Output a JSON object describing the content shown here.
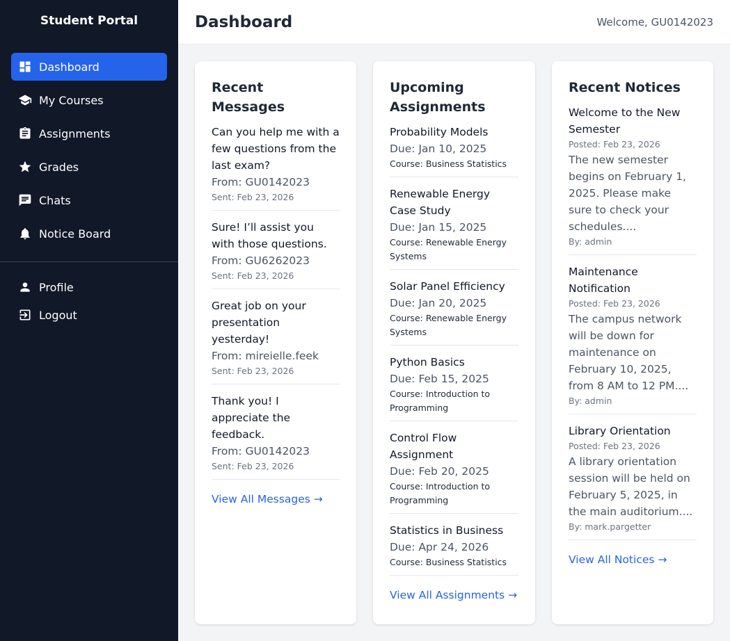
{
  "sidebar": {
    "brand": "Student Portal",
    "items": [
      {
        "label": "Dashboard",
        "icon": "dashboard-icon",
        "active": true
      },
      {
        "label": "My Courses",
        "icon": "school-icon"
      },
      {
        "label": "Assignments",
        "icon": "assignment-icon"
      },
      {
        "label": "Grades",
        "icon": "star-icon"
      },
      {
        "label": "Chats",
        "icon": "chat-icon"
      },
      {
        "label": "Notice Board",
        "icon": "bell-icon"
      }
    ],
    "bottom_items": [
      {
        "label": "Profile",
        "icon": "person-icon"
      },
      {
        "label": "Logout",
        "icon": "logout-icon"
      }
    ]
  },
  "header": {
    "title": "Dashboard",
    "welcome": "Welcome, GU0142023"
  },
  "messages": {
    "title": "Recent Messages",
    "items": [
      {
        "text": "Can you help me with a few questions from the last exam?",
        "from": "From: GU0142023",
        "sent": "Sent: Feb 23, 2026"
      },
      {
        "text": "Sure! I’ll assist you with those questions.",
        "from": "From: GU6262023",
        "sent": "Sent: Feb 23, 2026"
      },
      {
        "text": "Great job on your presentation yesterday!",
        "from": "From: mireielle.feek",
        "sent": "Sent: Feb 23, 2026"
      },
      {
        "text": "Thank you! I appreciate the feedback.",
        "from": "From: GU0142023",
        "sent": "Sent: Feb 23, 2026"
      }
    ],
    "view_all": "View All Messages →"
  },
  "assignments": {
    "title": "Upcoming Assignments",
    "items": [
      {
        "title": "Probability Models",
        "due": "Due: Jan 10, 2025",
        "course": "Course: Business Statistics"
      },
      {
        "title": "Renewable Energy Case Study",
        "due": "Due: Jan 15, 2025",
        "course": "Course: Renewable Energy Systems"
      },
      {
        "title": "Solar Panel Efficiency",
        "due": "Due: Jan 20, 2025",
        "course": "Course: Renewable Energy Systems"
      },
      {
        "title": "Python Basics",
        "due": "Due: Feb 15, 2025",
        "course": "Course: Introduction to Programming"
      },
      {
        "title": "Control Flow Assignment",
        "due": "Due: Feb 20, 2025",
        "course": "Course: Introduction to Programming"
      },
      {
        "title": "Statistics in Business",
        "due": "Due: Apr 24, 2026",
        "course": "Course: Business Statistics"
      }
    ],
    "view_all": "View All Assignments →"
  },
  "notices": {
    "title": "Recent Notices",
    "items": [
      {
        "title": "Welcome to the New Semester",
        "posted": "Posted: Feb 23, 2026",
        "body": "The new semester begins on February 1, 2025. Please make sure to check your schedules....",
        "by": "By: admin"
      },
      {
        "title": "Maintenance Notification",
        "posted": "Posted: Feb 23, 2026",
        "body": "The campus network will be down for maintenance on February 10, 2025, from 8 AM to 12 PM....",
        "by": "By: admin"
      },
      {
        "title": "Library Orientation",
        "posted": "Posted: Feb 23, 2026",
        "body": "A library orientation session will be held on February 5, 2025, in the main auditorium....",
        "by": "By: mark.pargetter"
      }
    ],
    "view_all": "View All Notices →"
  },
  "colors": {
    "sidebar_bg": "#111827",
    "accent": "#2563eb",
    "page_bg": "#f3f4f6"
  }
}
